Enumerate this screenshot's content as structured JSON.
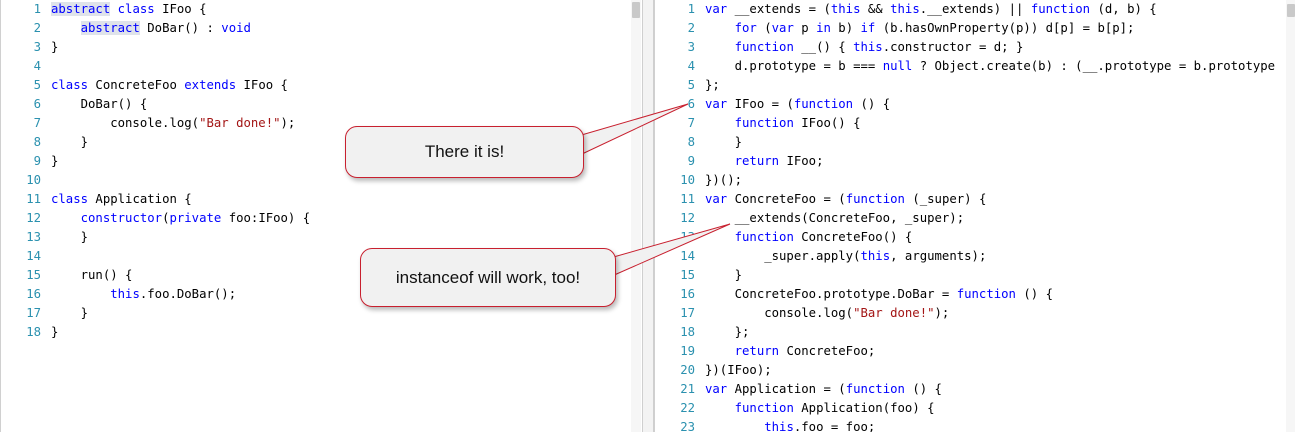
{
  "left_editor": {
    "lines": [
      {
        "n": "1",
        "t": [
          {
            "k": "kw hl",
            "v": "abstract"
          },
          {
            "v": " "
          },
          {
            "k": "kw",
            "v": "class"
          },
          {
            "v": " IFoo {"
          }
        ]
      },
      {
        "n": "2",
        "t": [
          {
            "v": "    "
          },
          {
            "k": "kw hl",
            "v": "abstract"
          },
          {
            "v": " DoBar() : "
          },
          {
            "k": "kw",
            "v": "void"
          }
        ]
      },
      {
        "n": "3",
        "t": [
          {
            "v": "}"
          }
        ]
      },
      {
        "n": "4",
        "t": []
      },
      {
        "n": "5",
        "t": [
          {
            "k": "kw",
            "v": "class"
          },
          {
            "v": " ConcreteFoo "
          },
          {
            "k": "kw",
            "v": "extends"
          },
          {
            "v": " IFoo {"
          }
        ]
      },
      {
        "n": "6",
        "t": [
          {
            "v": "    DoBar() {"
          }
        ]
      },
      {
        "n": "7",
        "t": [
          {
            "v": "        console.log("
          },
          {
            "k": "str",
            "v": "\"Bar done!\""
          },
          {
            "v": ");"
          }
        ]
      },
      {
        "n": "8",
        "t": [
          {
            "v": "    }"
          }
        ]
      },
      {
        "n": "9",
        "t": [
          {
            "v": "}"
          }
        ]
      },
      {
        "n": "10",
        "t": []
      },
      {
        "n": "11",
        "t": [
          {
            "k": "kw",
            "v": "class"
          },
          {
            "v": " Application {"
          }
        ]
      },
      {
        "n": "12",
        "t": [
          {
            "v": "    "
          },
          {
            "k": "kw",
            "v": "constructor"
          },
          {
            "v": "("
          },
          {
            "k": "kw",
            "v": "private"
          },
          {
            "v": " foo:IFoo) {"
          }
        ]
      },
      {
        "n": "13",
        "t": [
          {
            "v": "    }"
          }
        ]
      },
      {
        "n": "14",
        "t": []
      },
      {
        "n": "15",
        "t": [
          {
            "v": "    run() {"
          }
        ]
      },
      {
        "n": "16",
        "t": [
          {
            "v": "        "
          },
          {
            "k": "kw",
            "v": "this"
          },
          {
            "v": ".foo.DoBar();"
          }
        ]
      },
      {
        "n": "17",
        "t": [
          {
            "v": "    }"
          }
        ]
      },
      {
        "n": "18",
        "t": [
          {
            "v": "}"
          }
        ]
      }
    ]
  },
  "right_editor": {
    "lines": [
      {
        "n": "1",
        "t": [
          {
            "k": "kw",
            "v": "var"
          },
          {
            "v": " __extends = ("
          },
          {
            "k": "kw",
            "v": "this"
          },
          {
            "v": " && "
          },
          {
            "k": "kw",
            "v": "this"
          },
          {
            "v": ".__extends) || "
          },
          {
            "k": "kw",
            "v": "function"
          },
          {
            "v": " (d, b) {"
          }
        ]
      },
      {
        "n": "2",
        "t": [
          {
            "v": "    "
          },
          {
            "k": "kw",
            "v": "for"
          },
          {
            "v": " ("
          },
          {
            "k": "kw",
            "v": "var"
          },
          {
            "v": " p "
          },
          {
            "k": "kw",
            "v": "in"
          },
          {
            "v": " b) "
          },
          {
            "k": "kw",
            "v": "if"
          },
          {
            "v": " (b.hasOwnProperty(p)) d[p] = b[p];"
          }
        ]
      },
      {
        "n": "3",
        "t": [
          {
            "v": "    "
          },
          {
            "k": "kw",
            "v": "function"
          },
          {
            "v": " __() { "
          },
          {
            "k": "kw",
            "v": "this"
          },
          {
            "v": ".constructor = d; }"
          }
        ]
      },
      {
        "n": "4",
        "t": [
          {
            "v": "    d.prototype = b === "
          },
          {
            "k": "kw",
            "v": "null"
          },
          {
            "v": " ? Object.create(b) : (__.prototype = b.prototype"
          }
        ]
      },
      {
        "n": "5",
        "t": [
          {
            "v": "};"
          }
        ]
      },
      {
        "n": "6",
        "t": [
          {
            "k": "kw",
            "v": "var"
          },
          {
            "v": " IFoo = ("
          },
          {
            "k": "kw",
            "v": "function"
          },
          {
            "v": " () {"
          }
        ]
      },
      {
        "n": "7",
        "t": [
          {
            "v": "    "
          },
          {
            "k": "kw",
            "v": "function"
          },
          {
            "v": " IFoo() {"
          }
        ]
      },
      {
        "n": "8",
        "t": [
          {
            "v": "    }"
          }
        ]
      },
      {
        "n": "9",
        "t": [
          {
            "v": "    "
          },
          {
            "k": "kw",
            "v": "return"
          },
          {
            "v": " IFoo;"
          }
        ]
      },
      {
        "n": "10",
        "t": [
          {
            "v": "})();"
          }
        ]
      },
      {
        "n": "11",
        "t": [
          {
            "k": "kw",
            "v": "var"
          },
          {
            "v": " ConcreteFoo = ("
          },
          {
            "k": "kw",
            "v": "function"
          },
          {
            "v": " (_super) {"
          }
        ]
      },
      {
        "n": "12",
        "t": [
          {
            "v": "    __extends(ConcreteFoo, _super);"
          }
        ]
      },
      {
        "n": "13",
        "t": [
          {
            "v": "    "
          },
          {
            "k": "kw",
            "v": "function"
          },
          {
            "v": " ConcreteFoo() {"
          }
        ]
      },
      {
        "n": "14",
        "t": [
          {
            "v": "        _super.apply("
          },
          {
            "k": "kw",
            "v": "this"
          },
          {
            "v": ", arguments);"
          }
        ]
      },
      {
        "n": "15",
        "t": [
          {
            "v": "    }"
          }
        ]
      },
      {
        "n": "16",
        "t": [
          {
            "v": "    ConcreteFoo.prototype.DoBar = "
          },
          {
            "k": "kw",
            "v": "function"
          },
          {
            "v": " () {"
          }
        ]
      },
      {
        "n": "17",
        "t": [
          {
            "v": "        console.log("
          },
          {
            "k": "str",
            "v": "\"Bar done!\""
          },
          {
            "v": ");"
          }
        ]
      },
      {
        "n": "18",
        "t": [
          {
            "v": "    };"
          }
        ]
      },
      {
        "n": "19",
        "t": [
          {
            "v": "    "
          },
          {
            "k": "kw",
            "v": "return"
          },
          {
            "v": " ConcreteFoo;"
          }
        ]
      },
      {
        "n": "20",
        "t": [
          {
            "v": "})(IFoo);"
          }
        ]
      },
      {
        "n": "21",
        "t": [
          {
            "k": "kw",
            "v": "var"
          },
          {
            "v": " Application = ("
          },
          {
            "k": "kw",
            "v": "function"
          },
          {
            "v": " () {"
          }
        ]
      },
      {
        "n": "22",
        "t": [
          {
            "v": "    "
          },
          {
            "k": "kw",
            "v": "function"
          },
          {
            "v": " Application(foo) {"
          }
        ]
      },
      {
        "n": "23",
        "t": [
          {
            "v": "        "
          },
          {
            "k": "kw",
            "v": "this"
          },
          {
            "v": ".foo = foo;"
          }
        ]
      }
    ]
  },
  "callouts": {
    "first": "There it is!",
    "second": "instanceof will work, too!"
  },
  "colors": {
    "keyword": "#0000ff",
    "string": "#a31515",
    "line_number": "#2b91af",
    "callout_border": "#c8202f"
  }
}
